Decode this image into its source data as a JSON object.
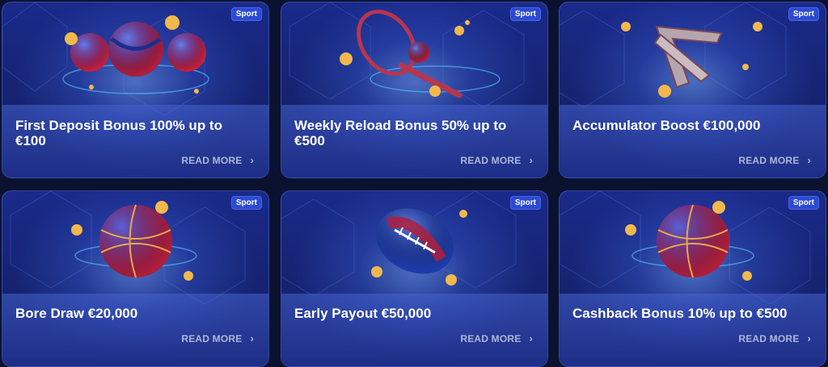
{
  "cards": [
    {
      "badge": "Sport",
      "title": "First Deposit Bonus 100% up to €100",
      "cta": "READ MORE",
      "art": "tennis-balls"
    },
    {
      "badge": "Sport",
      "title": "Weekly Reload Bonus 50% up to €500",
      "cta": "READ MORE",
      "art": "tennis-racket"
    },
    {
      "badge": "Sport",
      "title": "Accumulator Boost €100,000",
      "cta": "READ MORE",
      "art": "arrow"
    },
    {
      "badge": "Sport",
      "title": "Bore Draw €20,000",
      "cta": "READ MORE",
      "art": "basketball"
    },
    {
      "badge": "Sport",
      "title": "Early Payout €50,000",
      "cta": "READ MORE",
      "art": "american-football"
    },
    {
      "badge": "Sport",
      "title": "Cashback Bonus 10% up to €500",
      "cta": "READ MORE",
      "art": "basketball"
    }
  ],
  "colors": {
    "badge": "#2b4bd6",
    "card_bg": "#1a2a8a",
    "title": "#ffffff",
    "cta": "#aeb7d8"
  }
}
